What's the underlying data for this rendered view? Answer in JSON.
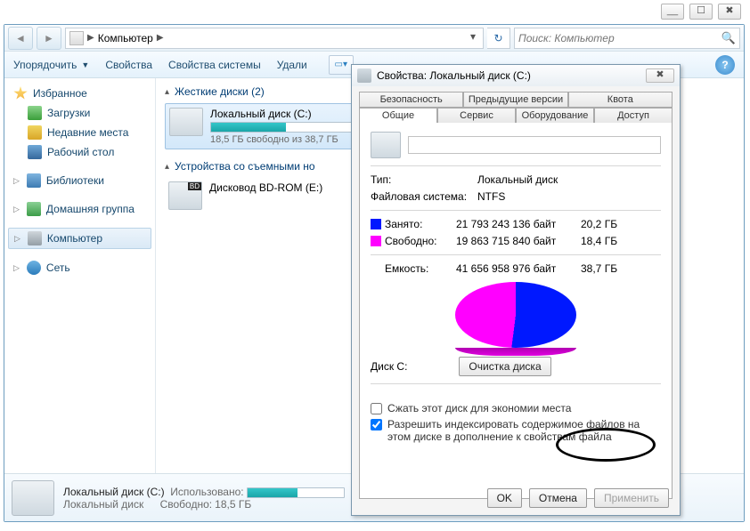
{
  "window_controls": {
    "min": "__",
    "max": "☐",
    "close": "✖"
  },
  "breadcrumb": {
    "label": "Компьютер",
    "arrow": "▶"
  },
  "search": {
    "placeholder": "Поиск: Компьютер"
  },
  "toolbar": {
    "organize": "Упорядочить",
    "properties": "Свойства",
    "system_properties": "Свойства системы",
    "uninstall": "Удали"
  },
  "sidebar": {
    "favorites": "Избранное",
    "downloads": "Загрузки",
    "recent": "Недавние места",
    "desktop": "Рабочий стол",
    "libraries": "Библиотеки",
    "homegroup": "Домашняя группа",
    "computer": "Компьютер",
    "network": "Сеть"
  },
  "sections": {
    "hdd": "Жесткие диски (2)",
    "removable": "Устройства со съемными но"
  },
  "drive": {
    "name": "Локальный диск (C:)",
    "sub": "18,5 ГБ свободно из 38,7 ГБ",
    "fill_pct": 52
  },
  "bd": {
    "name": "Дисковод BD-ROM (E:)"
  },
  "status": {
    "name": "Локальный диск (C:)",
    "local": "Локальный диск",
    "used_label": "Использовано:",
    "free_label": "Свободно:",
    "free_val": "18,5 ГБ"
  },
  "dlg": {
    "title": "Свойства: Локальный диск (C:)",
    "tabs_top": [
      "Безопасность",
      "Предыдущие версии",
      "Квота"
    ],
    "tabs_bot": [
      "Общие",
      "Сервис",
      "Оборудование",
      "Доступ"
    ],
    "type_label": "Тип:",
    "type_val": "Локальный диск",
    "fs_label": "Файловая система:",
    "fs_val": "NTFS",
    "used_label": "Занято:",
    "used_bytes": "21 793 243 136 байт",
    "used_gb": "20,2 ГБ",
    "free_label": "Свободно:",
    "free_bytes": "19 863 715 840 байт",
    "free_gb": "18,4 ГБ",
    "cap_label": "Емкость:",
    "cap_bytes": "41 656 958 976 байт",
    "cap_gb": "38,7 ГБ",
    "drive_c": "Диск C:",
    "cleanup": "Очистка диска",
    "compress": "Сжать этот диск для экономии места",
    "index": "Разрешить индексировать содержимое файлов на этом диске в дополнение к свойствам файла",
    "ok": "OK",
    "cancel": "Отмена",
    "apply": "Применить"
  },
  "chart_data": {
    "type": "pie",
    "title": "Диск C:",
    "series": [
      {
        "name": "Занято",
        "value": 21793243136,
        "display": "20,2 ГБ",
        "color": "#0018ff"
      },
      {
        "name": "Свободно",
        "value": 19863715840,
        "display": "18,4 ГБ",
        "color": "#ff00ff"
      }
    ],
    "total": {
      "name": "Емкость",
      "value": 41656958976,
      "display": "38,7 ГБ"
    }
  }
}
